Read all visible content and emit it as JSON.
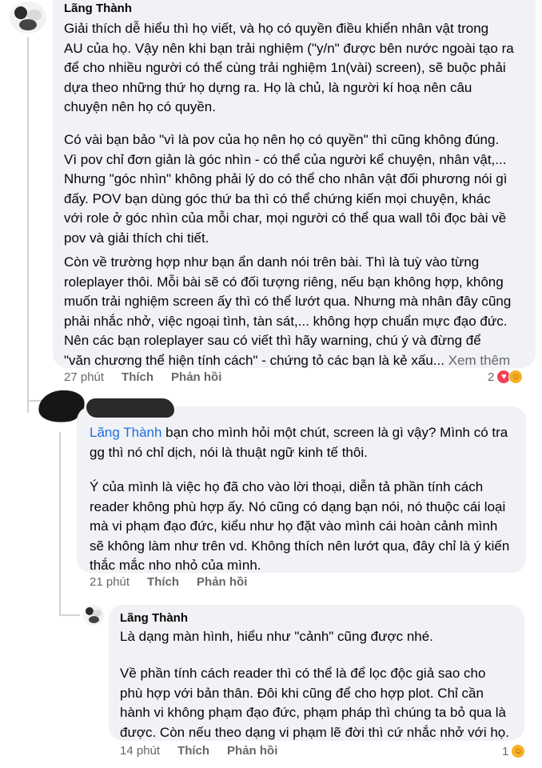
{
  "comment1": {
    "author": "Lãng Thành",
    "paragraph1": "Giải thích dễ hiểu thì họ viết, và họ có quyền điều khiển nhân vật trong\nAU của họ. Vậy nên khi bạn trải nghiệm (\"y/n\" được bên nước ngoài tạo ra\nđể cho nhiều người có thể cùng trải nghiệm 1n(vài) screen), sẽ buộc phải\ndựa theo những thứ họ dựng ra. Họ là chủ, là người kí hoạ nên câu\nchuyện nên họ có quyền.",
    "paragraph2": "Có vài bạn bảo \"vì là pov của họ nên họ có quyền\" thì cũng không đúng.\nVì pov chỉ đơn giản là góc nhìn - có thể của người kể chuyện, nhân vật,...\nNhưng \"góc nhìn\" không phải lý do có thể cho nhân vật đối phương nói gì\nđấy. POV bạn dùng góc thứ ba thì có thể chứng kiến mọi chuyện, khác\nvới role ở góc nhìn của mỗi char, mọi người có thể qua wall tôi đọc bài về\npov và giải thích chi tiết.",
    "paragraph3": "Còn về trường hợp như bạn ẩn danh nói trên bài. Thì là tuỳ vào từng\nroleplayer thôi. Mỗi bài sẽ có đối tượng riêng, nếu bạn không hợp, không\nmuốn trải nghiệm screen ấy thì có thể lướt qua. Nhưng mà nhân đây cũng\nphải nhắc nhở, việc ngoại tình, tàn sát,... không hợp chuẩn mực đạo đức.\nNên các bạn roleplayer sau có viết thì hãy warning, chú ý và đừng để\n\"văn chương thể hiện tính cách\" - chứng tỏ các bạn là kẻ xấu...",
    "see_more": "Xem thêm",
    "time": "27 phút",
    "like": "Thích",
    "reply": "Phản hồi",
    "reaction_count": "2"
  },
  "comment2": {
    "mention": "Lãng Thành",
    "paragraph1_rest": " bạn cho mình hỏi một chút, screen là gì vậy? Mình có tra\ngg thì nó chỉ dịch, nói là thuật ngữ kinh tế thôi.",
    "paragraph2": "Ý của mình là việc họ đã cho vào lời thoại, diễn tả phần tính cách\nreader không phù hợp ấy. Nó cũng có dạng bạn nói, nó thuộc cái loại\nmà vi phạm đạo đức, kiểu như họ đặt vào mình cái hoàn cảnh mình\nsẽ không làm như trên vd. Không thích nên lướt qua, đây chỉ là ý kiến\nthắc mắc nho nhỏ của mình.",
    "time": "21 phút",
    "like": "Thích",
    "reply": "Phản hồi"
  },
  "comment3": {
    "author": "Lãng Thành",
    "paragraph1": "Là dạng màn hình, hiểu như \"cảnh\" cũng được nhé.",
    "paragraph2": "Về phần tính cách reader thì có thể là để lọc độc giả sao cho\nphù hợp với bản thân. Đôi khi cũng để cho hợp plot. Chỉ cần\nhành vi không phạm đạo đức, phạm pháp thì chúng ta bỏ qua là\nđược. Còn nếu theo dạng vi phạm lẽ đời thì cứ nhắc nhở với họ.",
    "time": "14 phút",
    "like": "Thích",
    "reply": "Phản hồi",
    "reaction_count": "1"
  },
  "icons": {
    "love": "love-reaction-icon",
    "care": "care-reaction-icon"
  },
  "colors": {
    "bubble": "#f0f2f5",
    "mention": "#216fdb",
    "meta": "#65676b",
    "love": "#f33e58",
    "care": "#f7b125"
  }
}
